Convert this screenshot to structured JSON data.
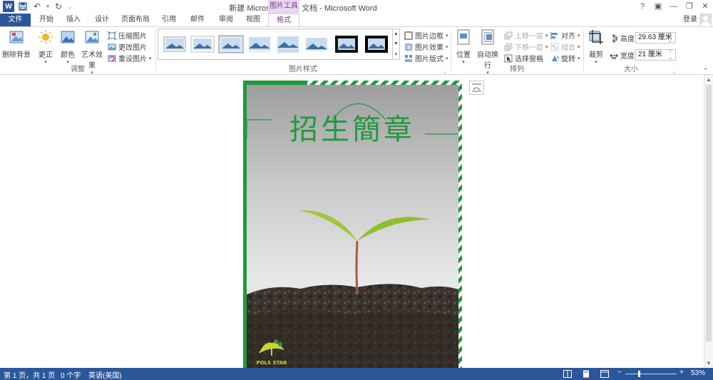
{
  "titlebar": {
    "title": "新建 Microsoft Word 文档 - Microsoft Word",
    "contextual_tab_group": "图片工具",
    "win_help": "?",
    "win_ribbon": "▣",
    "win_minimize": "—",
    "win_restore": "❐",
    "win_close": "✕"
  },
  "tabs": {
    "file": "文件",
    "items": [
      "开始",
      "插入",
      "设计",
      "页面布局",
      "引用",
      "邮件",
      "审阅",
      "视图",
      "格式"
    ],
    "login": "登录"
  },
  "ribbon": {
    "adjust": {
      "label": "调整",
      "remove_bg": "删除背景",
      "corrections": "更正",
      "color": "颜色",
      "artistic": "艺术效果",
      "compress": "压缩图片",
      "change": "更改图片",
      "reset": "重设图片"
    },
    "styles": {
      "label": "图片样式",
      "border": "图片边框",
      "effects": "图片效果",
      "layout": "图片版式"
    },
    "arrange": {
      "label": "排列",
      "position": "位置",
      "wrap": "自动换行",
      "forward": "上移一层",
      "backward": "下移一层",
      "selection": "选择窗格",
      "align": "对齐",
      "group": "组合",
      "rotate": "旋转"
    },
    "size": {
      "label": "大小",
      "crop": "裁剪",
      "height_label": "高度:",
      "height_value": "29.63 厘米",
      "width_label": "宽度:",
      "width_value": "21 厘米"
    }
  },
  "document": {
    "poster_title": "招生簡章",
    "logo_text": "POLS STAR"
  },
  "statusbar": {
    "page": "第 1 页，共 1 页",
    "words": "0 个字",
    "language": "英语(美国)",
    "zoom_minus": "−",
    "zoom_plus": "+",
    "zoom": "53%"
  },
  "colors": {
    "accent": "#2b579a",
    "context": "#7b3a96",
    "poster_green": "#1f9a3c"
  }
}
